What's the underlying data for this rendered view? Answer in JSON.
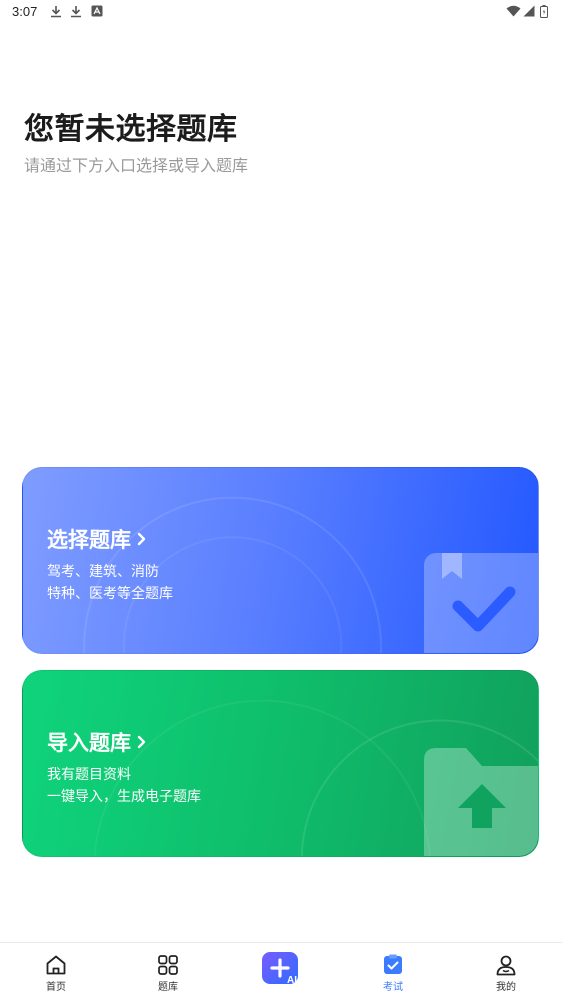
{
  "status_bar": {
    "time": "3:07",
    "icons": [
      "download-icon",
      "download-icon",
      "app-notification-icon",
      "wifi-icon",
      "signal-icon",
      "battery-icon"
    ]
  },
  "header": {
    "title": "您暂未选择题库",
    "subtitle": "请通过下方入口选择或导入题库"
  },
  "cards": {
    "select": {
      "title": "选择题库",
      "desc_line1": "驾考、建筑、消防",
      "desc_line2": "特种、医考等全题库",
      "icon": "bookmark-check-icon",
      "color_start": "#7f9cff",
      "color_end": "#2358ff"
    },
    "import": {
      "title": "导入题库",
      "desc_line1": "我有题目资料",
      "desc_line2": "一键导入，生成电子题库",
      "icon": "folder-upload-icon",
      "color_start": "#0fd47c",
      "color_end": "#11a05d"
    }
  },
  "bottom_nav": {
    "items": [
      {
        "label": "首页",
        "icon": "home-icon"
      },
      {
        "label": "题库",
        "icon": "grid-icon"
      },
      {
        "label": "",
        "icon": "ai-plus-icon"
      },
      {
        "label": "考试",
        "icon": "exam-icon"
      },
      {
        "label": "我的",
        "icon": "user-icon"
      }
    ],
    "active": "考试",
    "accent": "#3a7bff"
  }
}
